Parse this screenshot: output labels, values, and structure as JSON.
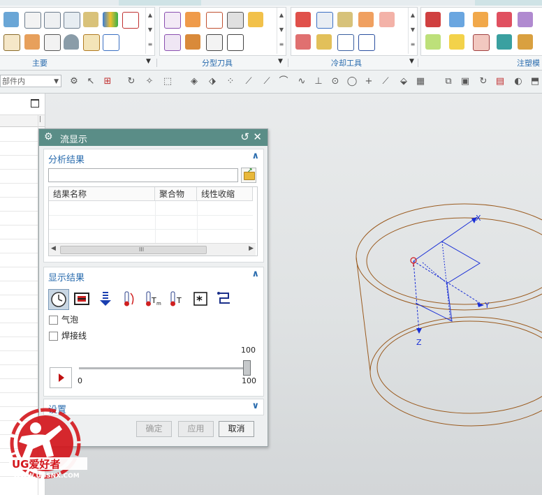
{
  "ribbon": {
    "groups": [
      {
        "label": "主要"
      },
      {
        "label": "分型刀具"
      },
      {
        "label": "冷却工具"
      },
      {
        "label": "注塑模"
      }
    ]
  },
  "toolbar": {
    "filter_select": "部件内"
  },
  "dialog": {
    "title": "流显示",
    "analysis_section": {
      "title": "分析结果",
      "file_value": "",
      "columns": [
        "结果名称",
        "聚合物",
        "线性收缩"
      ]
    },
    "display_section": {
      "title": "显示结果",
      "checkboxes": [
        {
          "label": "气泡",
          "checked": false
        },
        {
          "label": "焊接线",
          "checked": false
        }
      ],
      "slider": {
        "min_label": "0",
        "max_label": "100",
        "value_label": "100",
        "value": 100
      }
    },
    "settings_section": {
      "title": "设置"
    },
    "buttons": {
      "ok": "确定",
      "apply": "应用",
      "cancel": "取消"
    }
  },
  "viewport": {
    "axes": {
      "x": "X",
      "y": "Y",
      "z": "Z"
    },
    "colors": {
      "part_edges": "#9a5a1e",
      "csys": "#1a2fd6",
      "origin": "#d0161b"
    }
  },
  "watermark": {
    "brand": "UG爱好者",
    "url": "WWW.UGSNX.COM"
  }
}
